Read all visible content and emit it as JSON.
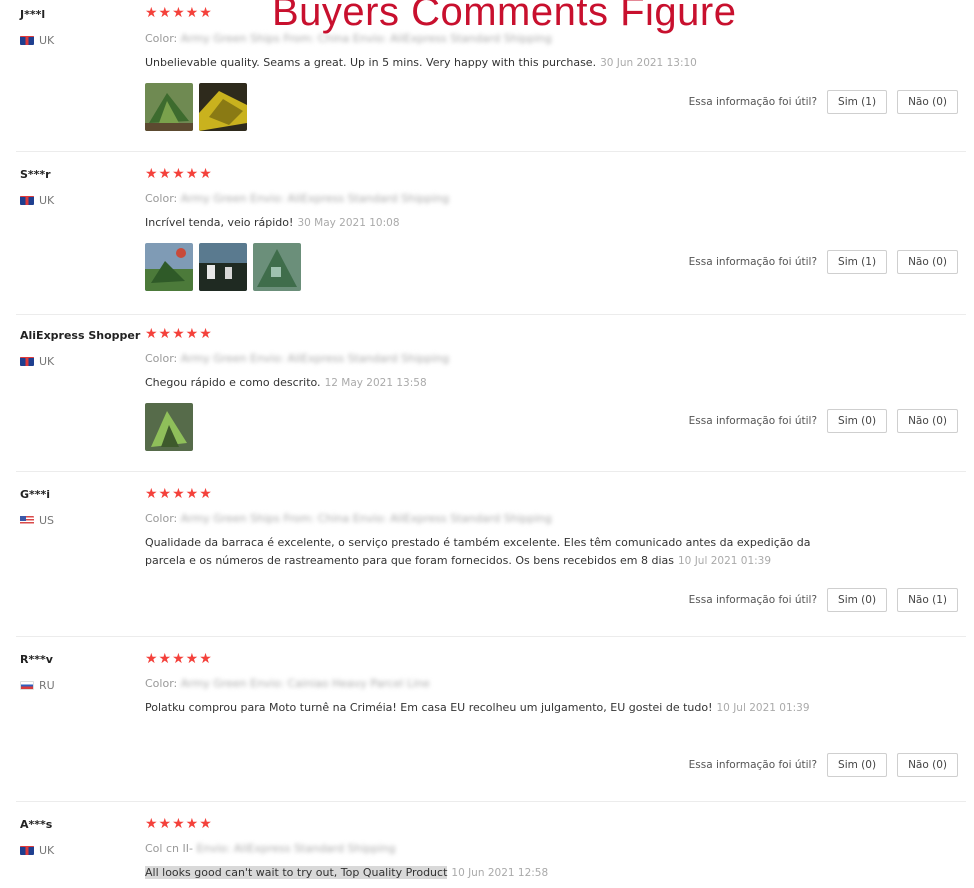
{
  "overlay_title": "Buyers Comments Figure",
  "helpful_prompt": "Essa informação foi útil?",
  "reviews": [
    {
      "name": "J***l",
      "country": "UK",
      "flag": "uk",
      "stars": "★★★★★",
      "meta_label": "Color:",
      "meta_blurred": "Army Green   Ships From: China   Envio: AliExpress Standard Shipping",
      "comment": "Unbelievable quality. Seams a great. Up in 5 mins. Very happy with this purchase.",
      "date": "30 Jun 2021 13:10",
      "yes": "Sim (1)",
      "no": "Não (0)"
    },
    {
      "name": "S***r",
      "country": "UK",
      "flag": "uk",
      "stars": "★★★★★",
      "meta_label": "Color:",
      "meta_blurred": "Army Green   Envio: AliExpress Standard Shipping",
      "comment": "Incrível tenda, veio rápido!",
      "date": "30 May 2021 10:08",
      "yes": "Sim (1)",
      "no": "Não (0)"
    },
    {
      "name": "AliExpress Shopper",
      "country": "UK",
      "flag": "uk",
      "stars": "★★★★★",
      "meta_label": "Color:",
      "meta_blurred": "Army Green   Envio: AliExpress Standard Shipping",
      "comment": "Chegou rápido e como descrito.",
      "date": "12 May 2021 13:58",
      "yes": "Sim (0)",
      "no": "Não (0)"
    },
    {
      "name": "G***i",
      "country": "US",
      "flag": "us",
      "stars": "★★★★★",
      "meta_label": "Color:",
      "meta_blurred": "Army Green   Ships From: China   Envio: AliExpress Standard Shipping",
      "comment": "Qualidade da barraca é excelente, o serviço prestado é também excelente. Eles têm comunicado antes da expedição da parcela e os números de rastreamento para que foram fornecidos. Os bens recebidos em 8 dias",
      "date": "10 Jul 2021 01:39",
      "yes": "Sim (0)",
      "no": "Não (1)"
    },
    {
      "name": "R***v",
      "country": "RU",
      "flag": "ru",
      "stars": "★★★★★",
      "meta_label": "Color:",
      "meta_blurred": "Army Green   Envio: Cainiao Heavy Parcel Line",
      "comment": "Polatku comprou para Moto turnê na Criméia! Em casa EU recolheu um julgamento, EU gostei de tudo!",
      "date": "10 Jul 2021 01:39",
      "yes": "Sim (0)",
      "no": "Não (0)"
    },
    {
      "name": "A***s",
      "country": "UK",
      "flag": "uk",
      "stars": "★★★★★",
      "meta_label": "Col cn II-",
      "meta_blurred": "Envio: AliExpress Standard Shipping",
      "comment": "All looks good can't wait to try out, Top Quality Product",
      "date": "10 Jun 2021 12:58"
    }
  ]
}
